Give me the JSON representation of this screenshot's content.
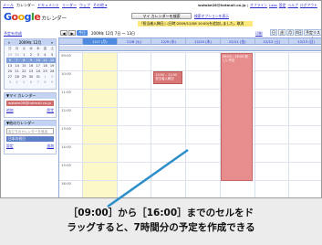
{
  "top_nav": [
    "メール",
    "カレンダー",
    "ドキュメント",
    "リーダー",
    "ウェブ",
    "その他 ▾"
  ],
  "account": {
    "email": "watake26@hotmail.co.jp",
    "sep": "|",
    "offline": "オフライン",
    "labs": "Labs",
    "settings": "設定",
    "help": "ヘルプ",
    "logout": "ログアウト"
  },
  "logo": {
    "text": "Google",
    "suffix": "カレンダー"
  },
  "search": {
    "button": "マイ カレンダーを検索",
    "options": "検索オプションを表示"
  },
  "notice": "『担当者入稿日』(日時:2009/12/08 10:00)を追加しました。取消",
  "sidebar": {
    "create": "予定を作成",
    "mini": {
      "prev": "«",
      "title": "2009年 12月",
      "next": "»",
      "dow": [
        "日",
        "月",
        "火",
        "水",
        "木",
        "金",
        "土"
      ],
      "weeks": [
        [
          "29",
          "30",
          "1",
          "2",
          "3",
          "4",
          "5"
        ],
        [
          "6",
          "7",
          "8",
          "9",
          "10",
          "11",
          "12"
        ],
        [
          "13",
          "14",
          "15",
          "16",
          "17",
          "18",
          "19"
        ],
        [
          "20",
          "21",
          "22",
          "23",
          "24",
          "25",
          "26"
        ],
        [
          "27",
          "28",
          "29",
          "30",
          "31",
          "1",
          "2"
        ],
        [
          "3",
          "4",
          "5",
          "6",
          "7",
          "8",
          "9"
        ]
      ]
    },
    "my_calendars": {
      "title": "▼マイ カレンダー",
      "item": "watake26@hotmail.co.jp",
      "add": "追加",
      "settings": "設定"
    },
    "other_calendars": {
      "title": "▼他のカレンダー",
      "placeholder": "友だちのカレンダーを追加",
      "item": "日本の祝日",
      "add": "追加",
      "settings": "設定"
    }
  },
  "toolbar": {
    "prev": "◀",
    "next": "▶",
    "today": "今日",
    "range": "2009年 12月 7日 ～ 13日",
    "print": "印刷",
    "views": [
      "日",
      "週",
      "月",
      "4日",
      "予定リスト"
    ]
  },
  "calendar": {
    "days": [
      "12/7 (月)",
      "12/8 (火)",
      "12/9 (水)",
      "12/10 (木)",
      "12/11 (金)",
      "12/12 (土)",
      "12/13 (日)"
    ],
    "hours": [
      "09:00",
      "10:00",
      "11:00",
      "12:00",
      "13:00",
      "14:00",
      "15:00",
      "16:00"
    ],
    "events": [
      {
        "text": "10:00 – 11:00 担当者入稿日",
        "day": 2
      },
      {
        "text": "09:00 – 16:00 新しい予定",
        "day": 4
      }
    ]
  },
  "caption": {
    "line1": "［09:00］から［16:00］までのセルをド",
    "line2": "ラッグすると、7時間分の予定を作成できる"
  }
}
